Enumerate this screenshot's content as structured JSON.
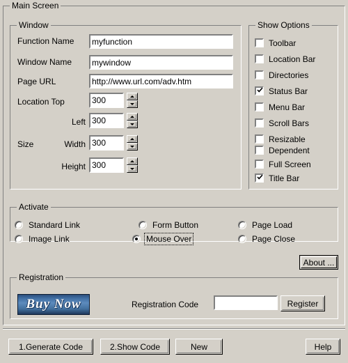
{
  "app": {
    "main_group_label": "Main Screen",
    "background": "#d4d0c8"
  },
  "window_group": {
    "label": "Window",
    "fields": [
      {
        "label": "Function Name",
        "value": "myfunction"
      },
      {
        "label": "Window Name",
        "value": "mywindow"
      },
      {
        "label": "Page URL",
        "value": "http://www.url.com/adv.htm"
      }
    ],
    "spinners": [
      {
        "label_main": "Location Top",
        "label_sub": "",
        "value": "300"
      },
      {
        "label_main": "",
        "label_sub": "Left",
        "value": "300"
      },
      {
        "label_main": "Size",
        "label_sub": "Width",
        "value": "300"
      },
      {
        "label_main": "",
        "label_sub": "Height",
        "value": "300"
      }
    ]
  },
  "show_options": {
    "label": "Show Options",
    "items": [
      {
        "label": "Toolbar",
        "checked": false
      },
      {
        "label": "Location Bar",
        "checked": false
      },
      {
        "label": "Directories",
        "checked": false
      },
      {
        "label": "Status Bar",
        "checked": true
      },
      {
        "label": "Menu Bar",
        "checked": false
      },
      {
        "label": "Scroll Bars",
        "checked": false
      },
      {
        "label": "Resizable",
        "checked": false
      },
      {
        "label": "Dependent",
        "checked": false
      },
      {
        "label": "Full Screen",
        "checked": false
      },
      {
        "label": "Title Bar",
        "checked": true
      }
    ]
  },
  "activate": {
    "label": "Activate",
    "options": [
      {
        "label": "Standard Link",
        "selected": false,
        "focused": false
      },
      {
        "label": "Image Link",
        "selected": false,
        "focused": false
      },
      {
        "label": "Form Button",
        "selected": false,
        "focused": false
      },
      {
        "label": "Mouse Over",
        "selected": true,
        "focused": true
      },
      {
        "label": "Page Load",
        "selected": false,
        "focused": false
      },
      {
        "label": "Page Close",
        "selected": false,
        "focused": false
      }
    ],
    "about_button": "About ..."
  },
  "registration": {
    "label": "Registration",
    "buy_now_label": "Buy Now",
    "code_label": "Registration Code",
    "code_value": "",
    "register_button": "Register"
  },
  "bottom_bar": {
    "generate_code": "1.Generate Code",
    "show_code": "2.Show Code",
    "new_button": "New",
    "help_button": "Help"
  }
}
